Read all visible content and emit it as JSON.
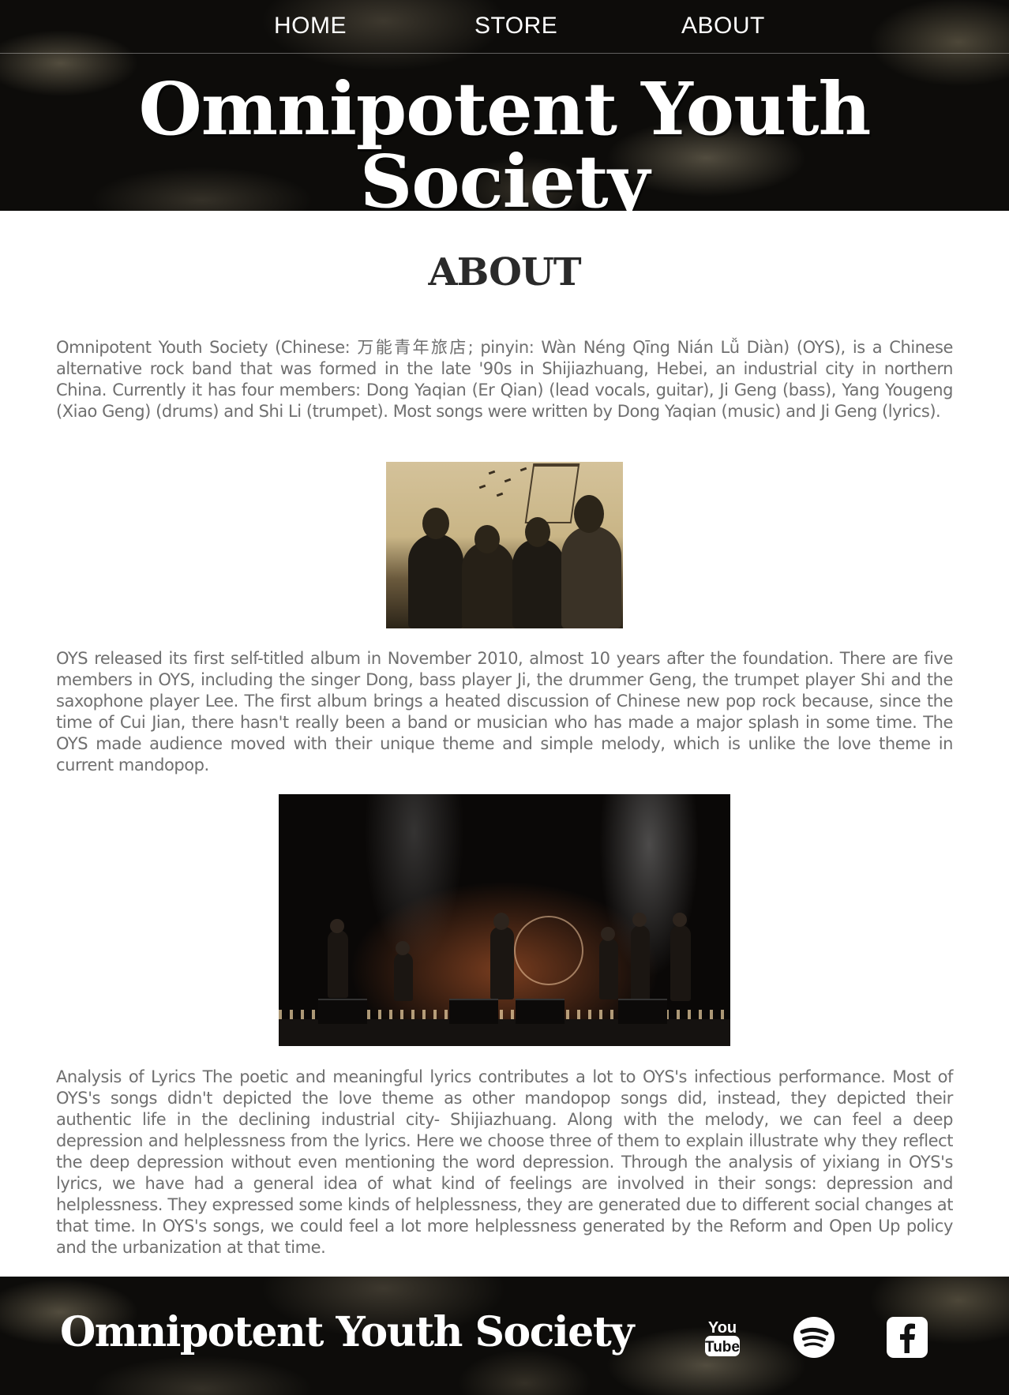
{
  "nav": {
    "items": [
      {
        "label": "HOME"
      },
      {
        "label": "STORE"
      },
      {
        "label": "ABOUT"
      }
    ]
  },
  "header": {
    "title": "Omnipotent Youth Society"
  },
  "main": {
    "heading": "ABOUT",
    "paragraphs": [
      "Omnipotent Youth Society (Chinese: 万能青年旅店; pinyin: Wàn Néng Qīng Nián Lǚ Diàn) (OYS), is a Chinese alternative rock band that was formed in the late '90s in Shijiazhuang, Hebei, an industrial city in northern China. Currently it has four members: Dong Yaqian (Er Qian) (lead vocals, guitar), Ji Geng (bass), Yang Yougeng (Xiao Geng) (drums) and Shi Li (trumpet). Most songs were written by Dong Yaqian (music) and Ji Geng (lyrics).",
      "OYS released its first self-titled album in November 2010, almost 10 years after the foundation. There are five members in OYS, including the singer Dong, bass player Ji, the drummer Geng, the trumpet player Shi and the saxophone player Lee. The first album brings a heated discussion of Chinese new pop rock because, since the time of Cui Jian, there hasn't really been a band or musician who has made a major splash in some time. The OYS made audience moved with their unique theme and simple melody, which is unlike the love theme in current mandopop.",
      "Analysis of Lyrics The poetic and meaningful lyrics contributes a lot to OYS's infectious performance. Most of OYS's songs didn't depicted the love theme as other mandopop songs did, instead, they depicted their authentic life in the declining industrial city- Shijiazhuang. Along with the melody, we can feel a deep depression and helplessness from the lyrics. Here we choose three of them to explain illustrate why they reflect the deep depression without even mentioning the word depression. Through the analysis of yixiang in OYS's lyrics, we have had a general idea of what kind of feelings are involved in their songs: depression and helplessness. They expressed some kinds of helplessness, they are generated due to different social changes at that time. In OYS's songs, we could feel a lot more helplessness generated by the Reform and Open Up policy and the urbanization at that time."
    ],
    "images": [
      {
        "icon": "band-sepia-photo"
      },
      {
        "icon": "band-concert-photo"
      }
    ]
  },
  "footer": {
    "title": "Omnipotent Youth Society",
    "social": [
      {
        "icon": "youtube-icon",
        "label": "You Tube"
      },
      {
        "icon": "spotify-icon"
      },
      {
        "icon": "facebook-icon"
      }
    ]
  },
  "colors": {
    "background": "#ffffff",
    "body_text": "#6f6f6f",
    "heading_text": "#2a2a2a",
    "banner": "#0d0c0a",
    "banner_text": "#ffffff"
  }
}
